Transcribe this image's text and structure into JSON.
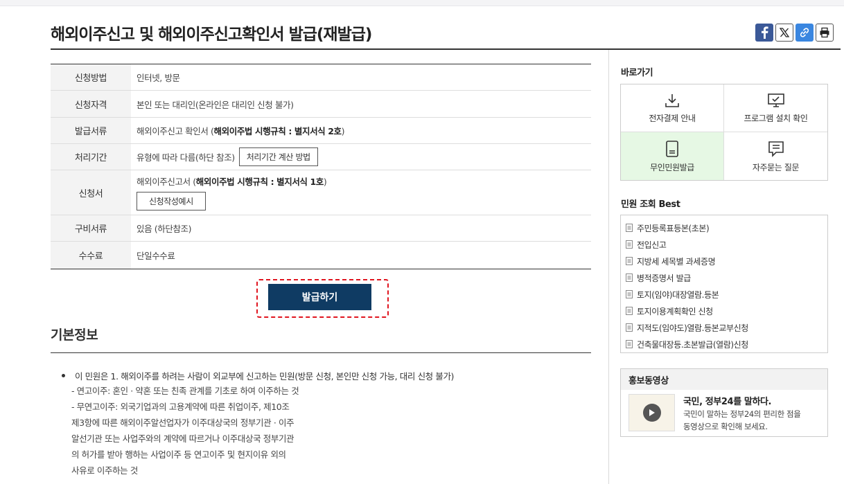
{
  "page": {
    "title": "해외이주신고 및 해외이주신고확인서 발급(재발급)"
  },
  "share": {
    "facebook_icon": "facebook-icon",
    "x_icon": "x-icon",
    "link_icon": "link-icon",
    "print_icon": "print-icon"
  },
  "info_table": {
    "rows": [
      {
        "label": "신청방법",
        "value": "인터넷, 방문"
      },
      {
        "label": "신청자격",
        "value": "본인 또는 대리인(온라인은 대리인 신청 불가)"
      },
      {
        "label": "발급서류",
        "value_prefix": "해외이주신고 확인서 (",
        "value_bold": "해외이주법 시행규칙 : 별지서식 2호",
        "value_suffix": ")"
      },
      {
        "label": "처리기간",
        "value": "유형에 따라 다름(하단 참조)",
        "button": "처리기간 계산 방법"
      },
      {
        "label": "신청서",
        "value_prefix": "해외이주신고서 (",
        "value_bold": "해외이주법 시행규칙 : 별지서식 1호",
        "value_suffix": ")",
        "button": "신청작성예시"
      },
      {
        "label": "구비서류",
        "value": "있음 (하단참조)"
      },
      {
        "label": "수수료",
        "value": "단일수수료"
      }
    ]
  },
  "issue_button": "발급하기",
  "basic_info": {
    "title": "기본정보",
    "lines": [
      "이 민원은 1. 해외이주를 하려는 사람이 외교부에 신고하는 민원(방문 신청, 본인만 신청 가능, 대리 신청 불가)",
      "- 연고이주: 혼인 · 약혼 또는 친족 관계를 기초로 하여 이주하는 것",
      "- 무연고이주: 외국기업과의 고용계약에 따른 취업이주, 제10조",
      "제3항에 따른 해외이주알선업자가 이주대상국의 정부기관 · 이주",
      "알선기관 또는 사업주와의 계약에 따르거나 이주대상국 정부기관",
      "의 허가를 받아 행하는 사업이주 등 연고이주 및 현지이유 외의",
      "사유로 이주하는 것"
    ]
  },
  "sidebar": {
    "shortcuts_title": "바로가기",
    "shortcuts": [
      {
        "label": "전자결제 안내",
        "icon": "download-icon"
      },
      {
        "label": "프로그램 설치 확인",
        "icon": "monitor-check-icon"
      },
      {
        "label": "무인민원발급",
        "icon": "kiosk-icon"
      },
      {
        "label": "자주묻는 질문",
        "icon": "chat-icon"
      }
    ],
    "best_title": "민원 조회 Best",
    "best_items": [
      "주민등록표등본(초본)",
      "전입신고",
      "지방세 세목별 과세증명",
      "병적증명서 발급",
      "토지(임야)대장열람.등본",
      "토지이용계획확인 신청",
      "지적도(임야도)열람.등본교부신청",
      "건축물대장등.초본발급(열람)신청"
    ],
    "promo": {
      "title": "홍보동영상",
      "video_title": "국민, 정부24를 말하다.",
      "video_text_1": "국민이 말하는 정부24의 편리한 점을",
      "video_text_2": "동영상으로 확인해 보세요."
    }
  }
}
